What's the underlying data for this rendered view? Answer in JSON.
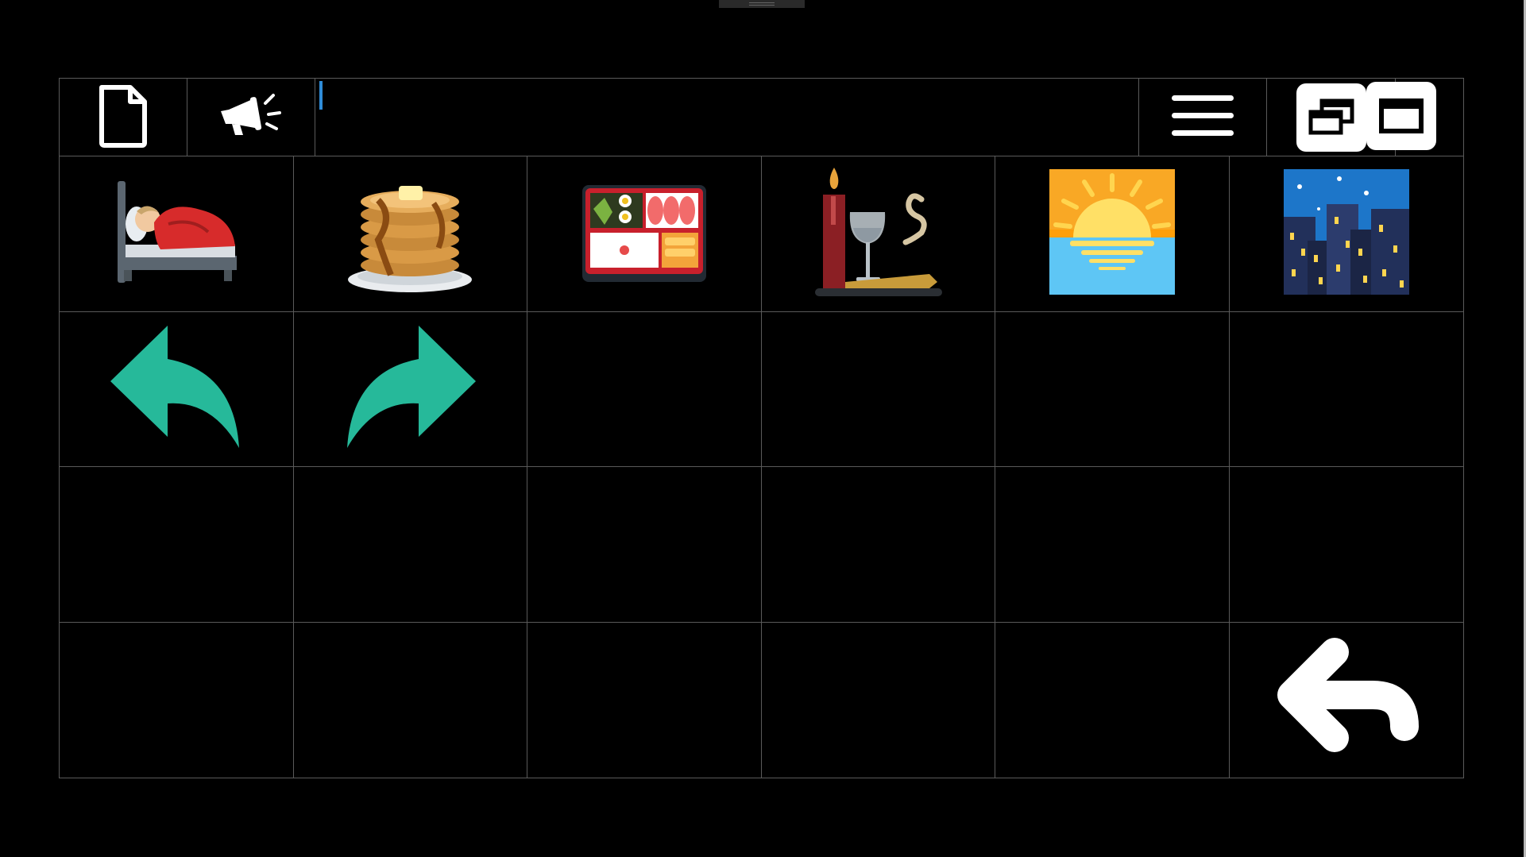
{
  "toolbar": {
    "buttons": [
      {
        "name": "new-document",
        "icon": "document-icon"
      },
      {
        "name": "speak",
        "icon": "megaphone-icon"
      },
      {
        "name": "menu",
        "icon": "hamburger-menu-icon"
      },
      {
        "name": "restore-window",
        "icon": "restore-window-icon"
      },
      {
        "name": "maximize-window",
        "icon": "maximize-window-icon"
      }
    ],
    "text_value": ""
  },
  "grid": {
    "rows": 4,
    "columns": 6,
    "cells": [
      {
        "icon": "sleeping-in-bed-icon"
      },
      {
        "icon": "pancakes-icon"
      },
      {
        "icon": "bento-box-icon"
      },
      {
        "icon": "candle-wine-incense-icon"
      },
      {
        "icon": "sunrise-over-sea-icon"
      },
      {
        "icon": "night-city-icon"
      },
      {
        "icon": "undo-arrow-icon"
      },
      {
        "icon": "redo-arrow-icon"
      },
      {},
      {},
      {},
      {},
      {},
      {},
      {},
      {},
      {},
      {},
      {},
      {},
      {},
      {},
      {},
      {
        "icon": "back-arrow-icon"
      }
    ]
  },
  "colors": {
    "background": "#000000",
    "grid_lines": "#5a5a5a",
    "arrow_teal": "#26b99a",
    "caret": "#2f8cd8"
  }
}
